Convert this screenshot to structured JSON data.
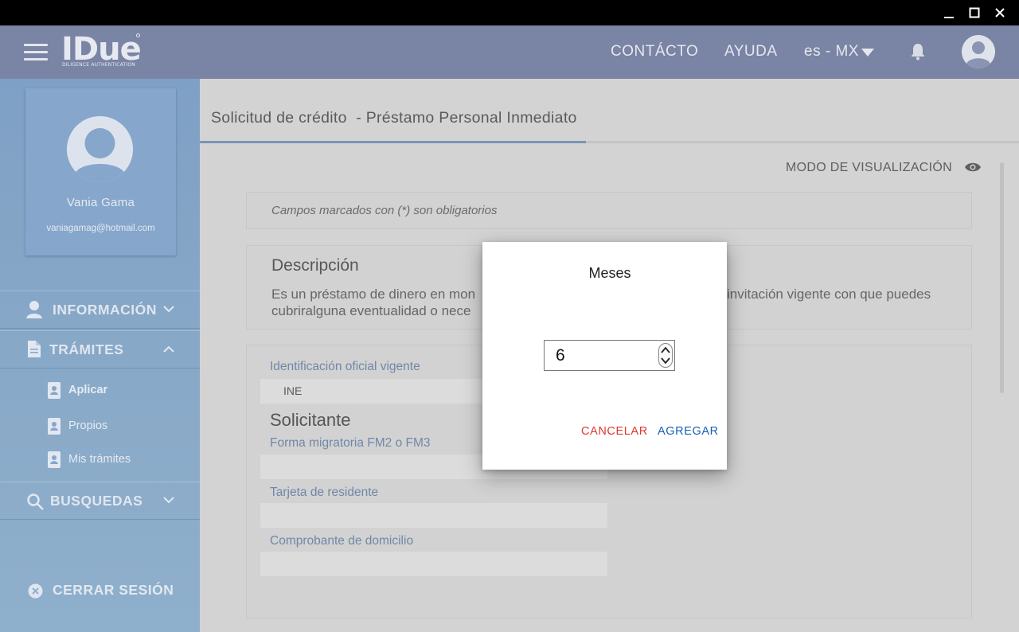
{
  "app": {
    "logo_text": "IDue",
    "logo_subtitle": "DILIGENCE AUTHENTICATION"
  },
  "header": {
    "contact": "CONTÁCTO",
    "help": "AYUDA",
    "language": "es - MX"
  },
  "profile": {
    "name": "Vania Gama",
    "email": "vaniagamag@hotmail.com"
  },
  "sidebar": {
    "items": [
      {
        "label": "INFORMACIÓN",
        "icon": "person-icon",
        "expanded": false
      },
      {
        "label": "TRÁMITES",
        "icon": "document-icon",
        "expanded": true
      },
      {
        "label": "BUSQUEDAS",
        "icon": "search-icon",
        "expanded": false
      }
    ],
    "subitems": [
      {
        "label": "Aplicar",
        "icon": "id-badge-icon",
        "active": true
      },
      {
        "label": "Propios",
        "icon": "id-badge-icon",
        "active": false
      },
      {
        "label": "Mis trámites",
        "icon": "id-badge-icon",
        "active": false
      }
    ],
    "logout": "CERRAR SESIÓN"
  },
  "main": {
    "title": "Solicitud de crédito  - Préstamo Personal Inmediato",
    "view_mode": "MODO DE VISUALIZACIÓN",
    "required_notice": "Campos marcados con (*) son obligatorios",
    "description_title": "Descripción",
    "description_line1_left": "Es un préstamo de dinero en mon",
    "description_line1_right": "invitación vigente con que puedes",
    "description_line2": "cubriralguna eventualidad o nece",
    "fields": [
      {
        "label": "Identificación oficial vigente",
        "value": "INE"
      },
      {
        "label": "Forma migratoria FM2 o FM3",
        "value": ""
      },
      {
        "label": "Tarjeta de residente",
        "value": ""
      },
      {
        "label": "Comprobante de domicilio",
        "value": ""
      }
    ],
    "section_title": "Solicitante"
  },
  "dialog": {
    "title": "Meses",
    "value": "6",
    "cancel": "CANCELAR",
    "confirm": "AGREGAR"
  },
  "colors": {
    "header": "#7a84a4",
    "sidebar": "#86a6cb",
    "overlay_content": "#d3d3d3",
    "cancel": "#e0392e",
    "confirm": "#1a5fb4",
    "field_label": "#7187a7"
  }
}
